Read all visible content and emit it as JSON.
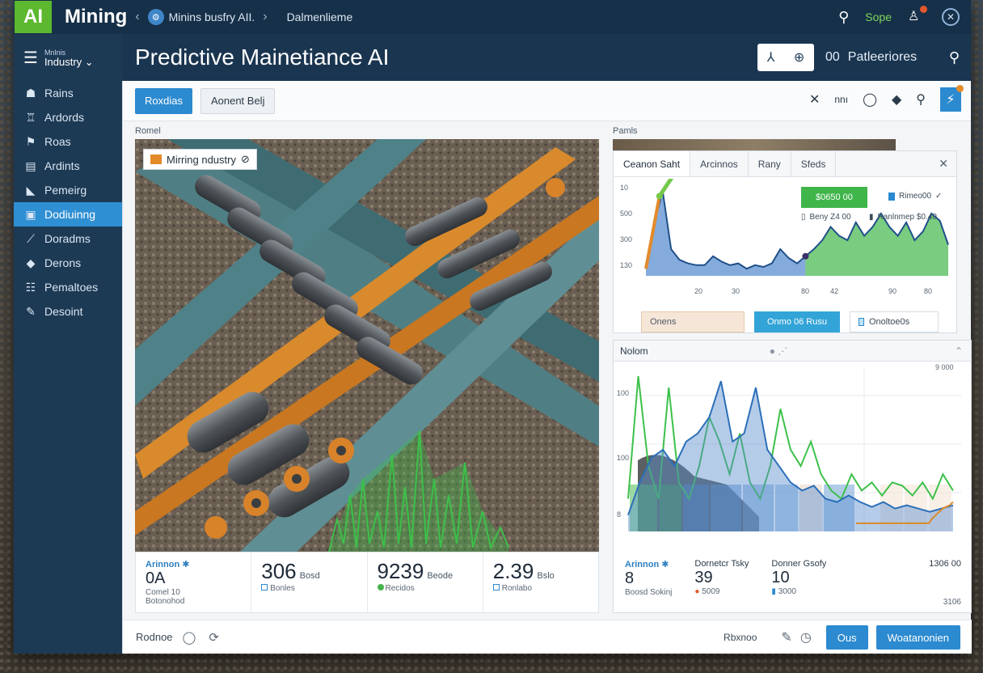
{
  "app": {
    "logo_text": "AI",
    "brand": "Mining",
    "breadcrumb_1": "Minins busfry AII.",
    "breadcrumb_2": "Dalmenlieme"
  },
  "topbar": {
    "user_label": "Sope",
    "colors": {
      "logo": "#5cb82e",
      "user": "#7fd65a",
      "badge": "#e2572b"
    }
  },
  "sidebar": {
    "header_small": "Mnlnis",
    "header_label": "Industry",
    "items": [
      {
        "label": "Rains",
        "icon": "person-icon"
      },
      {
        "label": "Ardords",
        "icon": "walk-icon"
      },
      {
        "label": "Roas",
        "icon": "run-icon"
      },
      {
        "label": "Ardints",
        "icon": "document-icon"
      },
      {
        "label": "Pemeirg",
        "icon": "flag-icon"
      },
      {
        "label": "Dodiuinng",
        "icon": "dashboard-icon",
        "active": true
      },
      {
        "label": "Doradms",
        "icon": "wrench-icon"
      },
      {
        "label": "Derons",
        "icon": "diamond-icon"
      },
      {
        "label": "Pemaltoes",
        "icon": "list-icon"
      },
      {
        "label": "Desoint",
        "icon": "tool-icon"
      }
    ]
  },
  "header": {
    "title": "Predictive Mainetiance AI",
    "label_prefix": "00",
    "label": "Patleeriores"
  },
  "toolbar": {
    "primary_label": "Roxdias",
    "secondary_label": "Aonent Belj",
    "tool_text": "nnı"
  },
  "image_panel": {
    "section_label": "Romel",
    "tag_text": "Mirring ndustry"
  },
  "stats": [
    {
      "label": "Arinnon",
      "value": "0A",
      "sub1": "Comel 10",
      "sub2": "Botonohod"
    },
    {
      "value": "306",
      "value_suffix": "Bosd",
      "sub": "Bonles"
    },
    {
      "value": "9239",
      "value_suffix": "Beode",
      "sub": "Recidos"
    },
    {
      "value": "2.39",
      "value_suffix": "Bslo",
      "sub": "Ronlabo"
    }
  ],
  "chart_card": {
    "section_label": "Pamls",
    "tabs": [
      "Ceanon Saht",
      "Arcinnos",
      "Rany",
      "Sfeds"
    ],
    "badge_value": "$0650 00",
    "legend_1": "Rimeo00",
    "legend_2": "Beny Z4 00",
    "legend_3": "Ranlnmep $0.40",
    "chip_1": "Onens",
    "chip_2": "Onmo 06 Rusu",
    "chip_3": "Onoltoe0s",
    "colors": {
      "badge": "#3fb54a",
      "chip_active": "#33a4d8"
    }
  },
  "chart_data": [
    {
      "type": "area",
      "x": [
        "20",
        "30",
        "80",
        "42",
        "90",
        "80"
      ],
      "y_ticks": [
        "10",
        "500",
        "300",
        "130"
      ],
      "series": [
        {
          "values": [
            8,
            60,
            95,
            30,
            18,
            14,
            12,
            12,
            22,
            16,
            12,
            14,
            8,
            12,
            10,
            14,
            30,
            20,
            14,
            22,
            30,
            40,
            55,
            45,
            40,
            60,
            45,
            55,
            70,
            55,
            45,
            60,
            40,
            50,
            70,
            62,
            35
          ]
        }
      ]
    },
    {
      "type": "area",
      "title": "Nolom",
      "y_ticks": [
        "9 000",
        "100",
        "100",
        "8"
      ],
      "series": [
        {
          "values": [
            20,
            95,
            40,
            20,
            88,
            30,
            20,
            40,
            70,
            55,
            35,
            60,
            30,
            20,
            40,
            75,
            50,
            40,
            55,
            35,
            25,
            20,
            35,
            25,
            30,
            22,
            30,
            28,
            22,
            30,
            20,
            35,
            25
          ]
        },
        {
          "values": [
            10,
            30,
            45,
            50,
            40,
            55,
            60,
            70,
            92,
            55,
            60,
            88,
            50,
            40,
            30,
            25,
            28,
            20,
            18,
            22,
            18,
            15,
            18,
            14,
            16,
            14,
            12,
            14,
            16
          ]
        },
        {
          "values": [
            5,
            5,
            5,
            5,
            5,
            5,
            5,
            5,
            5,
            5,
            5,
            5,
            5,
            5,
            5,
            5,
            5,
            5,
            5,
            5,
            5,
            5,
            8,
            10,
            12,
            14,
            15,
            16,
            18
          ]
        }
      ]
    }
  ],
  "trend_card": {
    "title": "Nolom",
    "y_top": "9 000",
    "bottom_right": "3106",
    "stats": [
      {
        "label": "Arinnon",
        "value": "8",
        "sub": "Boosd Sokinj"
      },
      {
        "label": "Dornetcr Tsky",
        "value": "39",
        "sub": "5009"
      },
      {
        "label": "Donner Gsofy",
        "value": "10",
        "sub": "3000"
      },
      {
        "label": "1306 00"
      }
    ]
  },
  "footer": {
    "label": "Rodnoe",
    "mid": "Rbxnoo",
    "ok_label": "Ous",
    "wide_label": "Woatanonien"
  }
}
